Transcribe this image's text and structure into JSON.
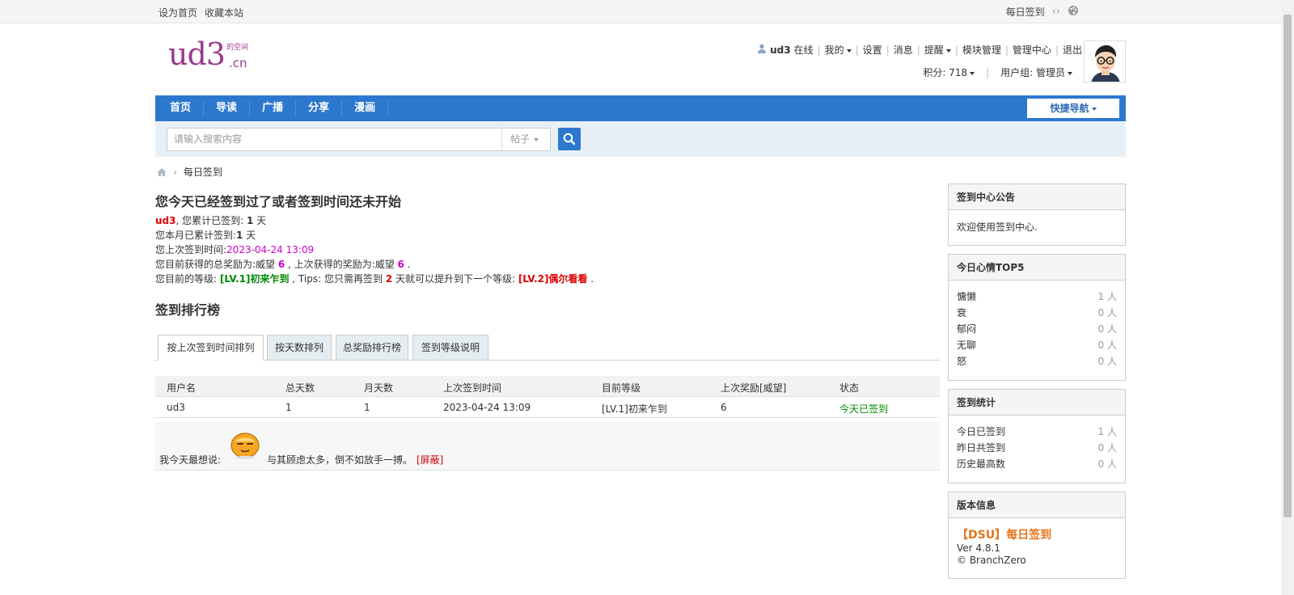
{
  "topbar": {
    "set_home": "设为首页",
    "bookmark": "收藏本站",
    "daily_sign": "每日签到",
    "code_icon": "code-icon",
    "palette_icon": "palette-icon"
  },
  "logo": {
    "main": "ud3",
    "sup": "的空间",
    "tld": ".cn"
  },
  "user_menu": {
    "username": "ud3",
    "status": "在线",
    "my": "我的",
    "settings": "设置",
    "messages": "消息",
    "reminders": "提醒",
    "module_mgmt": "模块管理",
    "admin_center": "管理中心",
    "logout": "退出",
    "points": "积分: 718",
    "user_group": "用户组: 管理员"
  },
  "nav": {
    "items": [
      "首页",
      "导读",
      "广播",
      "分享",
      "漫画"
    ],
    "quick_nav": "快捷导航"
  },
  "search": {
    "placeholder": "请输入搜索内容",
    "type": "帖子"
  },
  "breadcrumb": {
    "current": "每日签到"
  },
  "main": {
    "heading": "您今天已经签到过了或者签到时间还未开始",
    "line1_user": "ud3",
    "line1_text": ", 您累计已签到: ",
    "line1_days": "1",
    "line1_unit": " 天",
    "line2_text": "您本月已累计签到:",
    "line2_days": "1",
    "line2_unit": " 天",
    "line3_text": "您上次签到时间:",
    "line3_time": "2023-04-24 13:09",
    "line4_a": "您目前获得的总奖励为:威望 ",
    "line4_total": "6",
    "line4_b": " , 上次获得的奖励为:威望 ",
    "line4_last": "6",
    "line4_c": " .",
    "line5_a": "您目前的等级: ",
    "line5_level": "[LV.1]初来乍到",
    "line5_b": " , Tips: 您只需再签到 ",
    "line5_need": "2",
    "line5_c": " 天就可以提升到下一个等级: ",
    "line5_next": "[LV.2]偶尔看看",
    "line5_d": " .",
    "rank_title": "签到排行榜"
  },
  "tabs": [
    "按上次签到时间排列",
    "按天数排列",
    "总奖励排行榜",
    "签到等级说明"
  ],
  "table": {
    "headers": [
      "用户名",
      "总天数",
      "月天数",
      "上次签到时间",
      "目前等级",
      "上次奖励[威望]",
      "状态"
    ],
    "rows": [
      [
        "ud3",
        "1",
        "1",
        "2023-04-24 13:09",
        "[LV.1]初来乍到",
        "6",
        "今天已签到"
      ]
    ]
  },
  "say": {
    "label": "我今天最想说:",
    "mood_icon": "mood-face-icon",
    "message": "与其顾虑太多，倒不如放手一搏。",
    "hide": "[屏蔽]"
  },
  "sidebar": {
    "notice_title": "签到中心公告",
    "notice_body": "欢迎使用签到中心.",
    "mood_title": "今日心情TOP5",
    "moods": [
      {
        "k": "慵懒",
        "v": "1 人"
      },
      {
        "k": "衰",
        "v": "0 人"
      },
      {
        "k": "郁闷",
        "v": "0 人"
      },
      {
        "k": "无聊",
        "v": "0 人"
      },
      {
        "k": "怒",
        "v": "0 人"
      }
    ],
    "stats_title": "签到统计",
    "stats": [
      {
        "k": "今日已签到",
        "v": "1 人"
      },
      {
        "k": "昨日共签到",
        "v": "0 人"
      },
      {
        "k": "历史最高数",
        "v": "0 人"
      }
    ],
    "version_title": "版本信息",
    "version_name": "【DSU】每日签到",
    "version_num": "Ver 4.8.1",
    "version_copy": "© BranchZero"
  }
}
